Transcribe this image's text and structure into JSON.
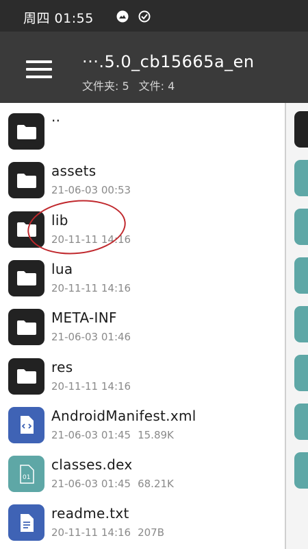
{
  "statusbar": {
    "text": "周四 01:55"
  },
  "appbar": {
    "title": "···.5.0_cb15665a_en",
    "folders_label": "文件夹: 5",
    "files_label": "文件: 4"
  },
  "files": [
    {
      "name": "..",
      "date": "",
      "size": "",
      "type": "folder"
    },
    {
      "name": "assets",
      "date": "21-06-03 00:53",
      "size": "",
      "type": "folder"
    },
    {
      "name": "lib",
      "date": "20-11-11 14:16",
      "size": "",
      "type": "folder"
    },
    {
      "name": "lua",
      "date": "20-11-11 14:16",
      "size": "",
      "type": "folder"
    },
    {
      "name": "META-INF",
      "date": "21-06-03 01:46",
      "size": "",
      "type": "folder"
    },
    {
      "name": "res",
      "date": "20-11-11 14:16",
      "size": "",
      "type": "folder"
    },
    {
      "name": "AndroidManifest.xml",
      "date": "21-06-03 01:45",
      "size": "15.89K",
      "type": "xml"
    },
    {
      "name": "classes.dex",
      "date": "21-06-03 01:45",
      "size": "68.21K",
      "type": "dex"
    },
    {
      "name": "readme.txt",
      "date": "20-11-11 14:16",
      "size": "207B",
      "type": "txt"
    }
  ],
  "icons": {
    "folder": "folder-icon",
    "xml": "xml-file-icon",
    "dex": "dex-file-icon",
    "txt": "text-file-icon",
    "menu": "hamburger-menu-icon",
    "status1": "photo-notification-icon",
    "status2": "check-circle-icon"
  },
  "colors": {
    "folder": "#222222",
    "xml": "#3f63b5",
    "dex": "#5ea7a6",
    "txt": "#3f63b5",
    "annotation": "#c0282d"
  }
}
